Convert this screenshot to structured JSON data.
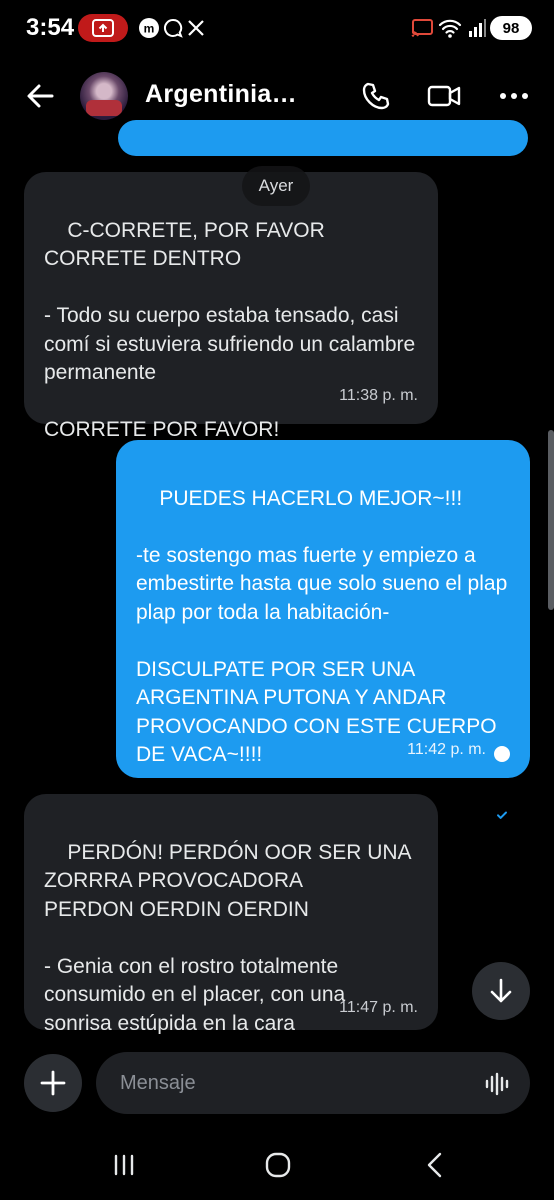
{
  "status_bar": {
    "time": "3:54",
    "battery": "98",
    "icons": [
      "screen-record-icon",
      "threads-icon",
      "chat-bubble-icon",
      "x-logo-icon",
      "cast-icon",
      "wifi-icon",
      "signal-icon"
    ]
  },
  "header": {
    "contact_name": "Argentinia…",
    "icons": [
      "back-arrow-icon",
      "phone-icon",
      "video-camera-icon",
      "more-icon"
    ]
  },
  "date_divider": "Ayer",
  "messages": [
    {
      "direction": "in",
      "text": "C-CORRETE, POR FAVOR\nCORRETE DENTRO\n\n- Todo su cuerpo estaba tensado, casi comí si estuviera sufriendo un calambre permanente\n\nCORRETE POR FAVOR!",
      "time": "11:38 p. m."
    },
    {
      "direction": "out",
      "text": "PUEDES HACERLO MEJOR~!!!\n\n-te sostengo mas fuerte y empiezo a embestirte hasta que solo sueno el plap plap por toda la habitación-\n\nDISCULPATE POR SER UNA ARGENTINA PUTONA Y ANDAR PROVOCANDO CON ESTE CUERPO DE VACA~!!!!",
      "time": "11:42 p. m.",
      "status": "read"
    },
    {
      "direction": "in",
      "text": "PERDÓN! PERDÓN OOR SER UNA ZORRRA PROVOCADORA\nPERDON OERDIN OERDIN\n\n- Genia con el rostro totalmente consumido en el placer, con una sonrisa estúpida en la cara",
      "time": "11:47 p. m."
    }
  ],
  "composer": {
    "placeholder": "Mensaje"
  },
  "colors": {
    "background": "#000000",
    "incoming_bubble": "#1f2125",
    "outgoing_bubble": "#1d9bf0",
    "record_pill": "#c01a1a"
  }
}
